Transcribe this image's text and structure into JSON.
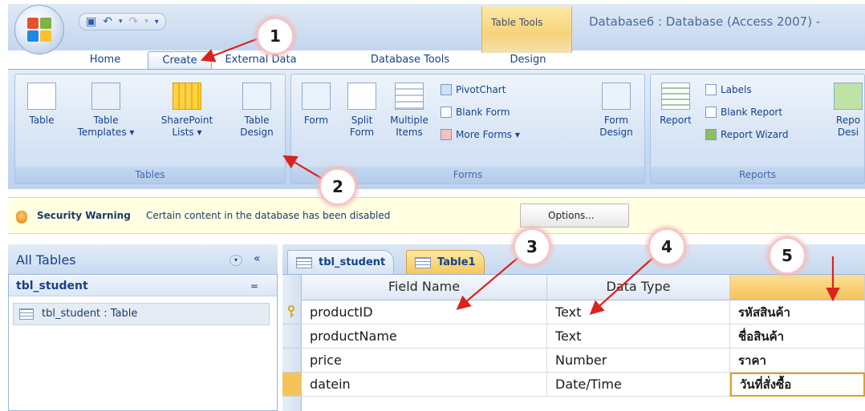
{
  "title_bar": {
    "context_header": "Table Tools",
    "window_title": "Database6 : Database (Access 2007) -"
  },
  "tabs": {
    "home": "Home",
    "create": "Create",
    "external_data": "External Data",
    "database_tools": "Database Tools",
    "design": "Design"
  },
  "ribbon": {
    "tables": {
      "label": "Tables",
      "table": "Table",
      "table_templates": "Table\nTemplates ▾",
      "sharepoint_lists": "SharePoint\nLists ▾",
      "table_design": "Table\nDesign"
    },
    "forms": {
      "label": "Forms",
      "form": "Form",
      "split_form": "Split\nForm",
      "multiple_items": "Multiple\nItems",
      "pivotchart": "PivotChart",
      "blank_form": "Blank Form",
      "more_forms": "More Forms ▾",
      "form_design": "Form\nDesign"
    },
    "reports": {
      "label": "Reports",
      "report": "Report",
      "labels": "Labels",
      "blank_report": "Blank Report",
      "report_wizard": "Report Wizard",
      "report_design": "Repo\nDesi"
    }
  },
  "security": {
    "title": "Security Warning",
    "message": "Certain content in the database has been disabled",
    "options_button": "Options..."
  },
  "nav": {
    "header": "All Tables",
    "collapse": "«",
    "dropdown": "▾",
    "group": "tbl_student",
    "group_toggle": "≈",
    "item": "tbl_student : Table"
  },
  "doc_tabs": {
    "tab1": "tbl_student",
    "tab2": "Table1"
  },
  "grid": {
    "headers": [
      "Field Name",
      "Data Type",
      ""
    ],
    "rows": [
      {
        "field": "productID",
        "type": "Text",
        "desc": "รหัสสินค้า"
      },
      {
        "field": "productName",
        "type": "Text",
        "desc": "ชื่อสินค้า"
      },
      {
        "field": "price",
        "type": "Number",
        "desc": "ราคา"
      },
      {
        "field": "datein",
        "type": "Date/Time",
        "desc": "วันที่สั่งซื้อ"
      }
    ]
  },
  "callouts": [
    "1",
    "2",
    "3",
    "4",
    "5"
  ],
  "colors": {
    "ribbon_text": "#15428b",
    "context_tab": "#f6c85a",
    "arrow": "#d9241c",
    "security_bg": "#ffffe1"
  }
}
